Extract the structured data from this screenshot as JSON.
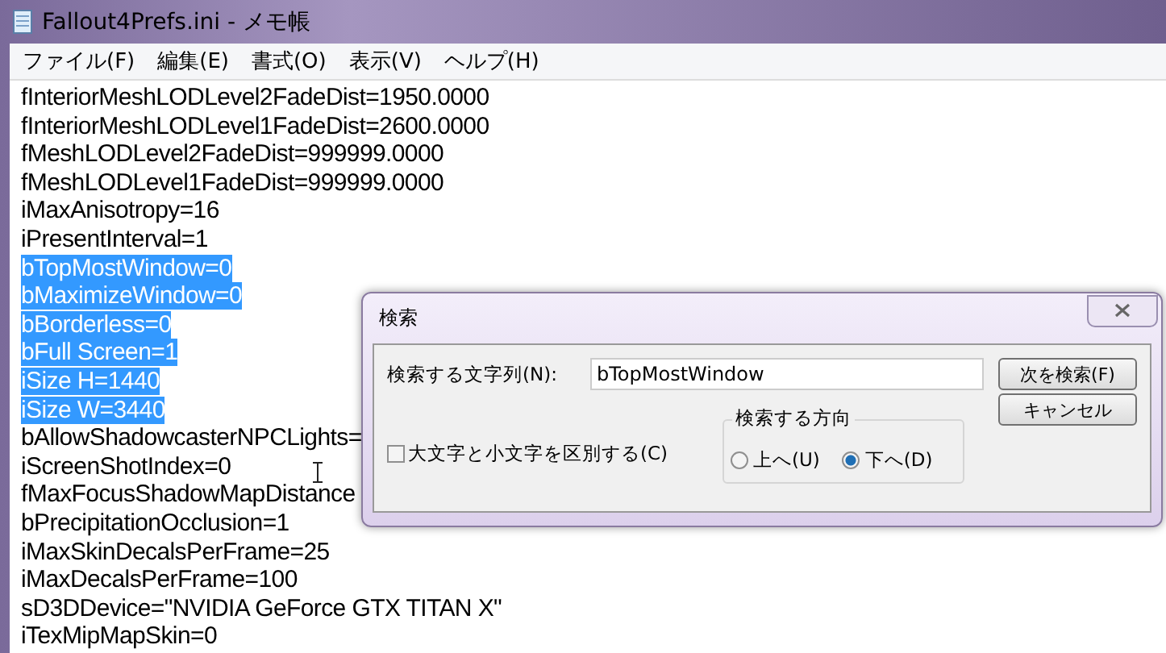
{
  "window": {
    "title": "Fallout4Prefs.ini - メモ帳"
  },
  "menu": [
    "ファイル(F)",
    "編集(E)",
    "書式(O)",
    "表示(V)",
    "ヘルプ(H)"
  ],
  "lines": [
    {
      "text": "fInteriorMeshLODLevel2FadeDist=1950.0000",
      "selected": false
    },
    {
      "text": "fInteriorMeshLODLevel1FadeDist=2600.0000",
      "selected": false
    },
    {
      "text": "fMeshLODLevel2FadeDist=999999.0000",
      "selected": false
    },
    {
      "text": "fMeshLODLevel1FadeDist=999999.0000",
      "selected": false
    },
    {
      "text": "iMaxAnisotropy=16",
      "selected": false
    },
    {
      "text": "iPresentInterval=1",
      "selected": false
    },
    {
      "text": "bTopMostWindow=0",
      "selected": true
    },
    {
      "text": "bMaximizeWindow=0",
      "selected": true
    },
    {
      "text": "bBorderless=0",
      "selected": true
    },
    {
      "text": "bFull Screen=1",
      "selected": true
    },
    {
      "text": "iSize H=1440",
      "selected": true
    },
    {
      "text": "iSize W=3440",
      "selected": true
    },
    {
      "text": "bAllowShadowcasterNPCLights=",
      "selected": false
    },
    {
      "text": "iScreenShotIndex=0",
      "selected": false
    },
    {
      "text": "fMaxFocusShadowMapDistance",
      "selected": false
    },
    {
      "text": "bPrecipitationOcclusion=1",
      "selected": false
    },
    {
      "text": "iMaxSkinDecalsPerFrame=25",
      "selected": false
    },
    {
      "text": "iMaxDecalsPerFrame=100",
      "selected": false
    },
    {
      "text": "sD3DDevice=\"NVIDIA GeForce GTX TITAN X\"",
      "selected": false
    },
    {
      "text": "iTexMipMapSkin=0",
      "selected": false
    }
  ],
  "dialog": {
    "title": "検索",
    "find_label": "検索する文字列(N):",
    "find_value": "bTopMostWindow",
    "find_next_button": "次を検索(F)",
    "cancel_button": "キャンセル",
    "match_case": {
      "label": "大文字と小文字を区別する(C)",
      "checked": false
    },
    "direction": {
      "label": "検索する方向",
      "options": [
        {
          "label": "上へ(U)",
          "selected": false
        },
        {
          "label": "下へ(D)",
          "selected": true
        }
      ]
    }
  }
}
